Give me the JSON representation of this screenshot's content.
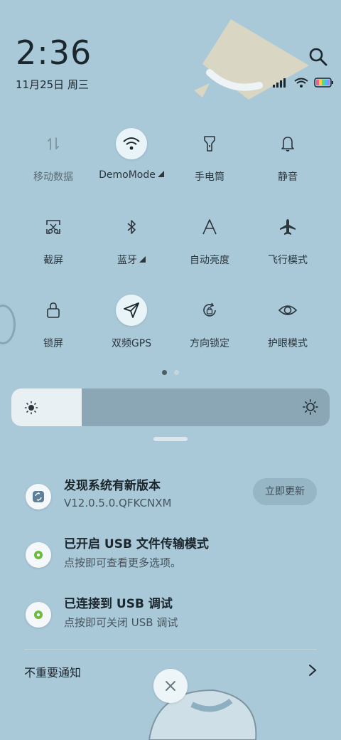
{
  "header": {
    "time": "2:36",
    "date": "11月25日 周三"
  },
  "status_icons": [
    "signal-icon",
    "wifi-icon",
    "battery-icon"
  ],
  "quick_tiles": [
    {
      "label": "移动数据",
      "icon": "data-arrows-icon",
      "active": false,
      "dim": true
    },
    {
      "label": "DemoMode",
      "icon": "wifi-icon",
      "active": true,
      "expandable": true
    },
    {
      "label": "手电筒",
      "icon": "flashlight-icon",
      "active": false
    },
    {
      "label": "静音",
      "icon": "bell-icon",
      "active": false
    },
    {
      "label": "截屏",
      "icon": "screenshot-icon",
      "active": false
    },
    {
      "label": "蓝牙",
      "icon": "bluetooth-icon",
      "active": false,
      "expandable": true
    },
    {
      "label": "自动亮度",
      "icon": "auto-brightness-icon",
      "active": false
    },
    {
      "label": "飞行模式",
      "icon": "airplane-icon",
      "active": false
    },
    {
      "label": "锁屏",
      "icon": "lock-icon",
      "active": false
    },
    {
      "label": "双频GPS",
      "icon": "location-icon",
      "active": true
    },
    {
      "label": "方向锁定",
      "icon": "rotation-lock-icon",
      "active": false
    },
    {
      "label": "护眼模式",
      "icon": "eye-icon",
      "active": false
    }
  ],
  "page_indicator": {
    "current": 1,
    "total": 2
  },
  "brightness": {
    "level": 0.22
  },
  "notifications": [
    {
      "title": "发现系统有新版本",
      "subtitle": "V12.0.5.0.QFKCNXM",
      "action": "立即更新",
      "icon": "update-icon"
    },
    {
      "title": "已开启 USB 文件传输模式",
      "subtitle": "点按即可查看更多选项。",
      "icon": "android-settings-icon"
    },
    {
      "title": "已连接到 USB 调试",
      "subtitle": "点按即可关闭 USB 调试",
      "icon": "android-settings-icon"
    }
  ],
  "footer": {
    "unimportant_label": "不重要通知"
  },
  "colors": {
    "background": "#a9c8d8",
    "tile_on": "#e9f4f8",
    "brightness_track": "#8ba7b5",
    "brightness_fill": "#e8f0f4",
    "accent_green": "#6dbb3e"
  }
}
